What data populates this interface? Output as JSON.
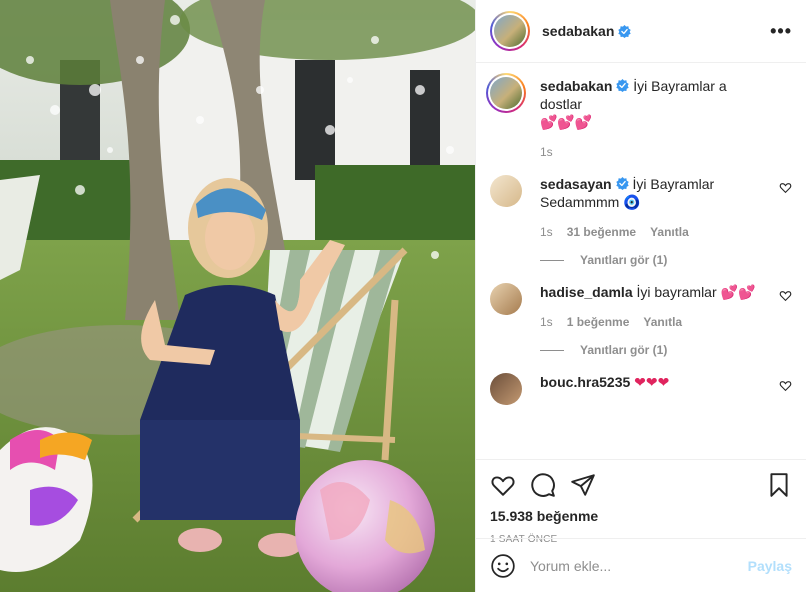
{
  "post": {
    "username": "sedabakan",
    "more_label": "•••"
  },
  "caption": {
    "username": "sedabakan",
    "text": "İyi Bayramlar a dostlar",
    "emojis": "💕💕💕",
    "time": "1s"
  },
  "comments": [
    {
      "username": "sedasayan",
      "text": "İyi Bayramlar Sedammmm 🧿",
      "time": "1s",
      "likes": "31 beğenme",
      "reply": "Yanıtla",
      "view_replies": "Yanıtları gör (1)"
    },
    {
      "username": "hadise_damla",
      "text": "İyi bayramlar 💕💕",
      "time": "1s",
      "likes": "1 beğenme",
      "reply": "Yanıtla",
      "view_replies": "Yanıtları gör (1)"
    },
    {
      "username": "bouc.hra5235",
      "text": "❤❤❤"
    }
  ],
  "footer": {
    "likes": "15.938 beğenme",
    "time_ago": "1 SAAT ÖNCE",
    "comment_placeholder": "Yorum ekle...",
    "post_label": "Paylaş"
  },
  "colors": {
    "verified": "#3897f0",
    "post_button": "#b2dffc",
    "muted": "#8e8e8e"
  }
}
